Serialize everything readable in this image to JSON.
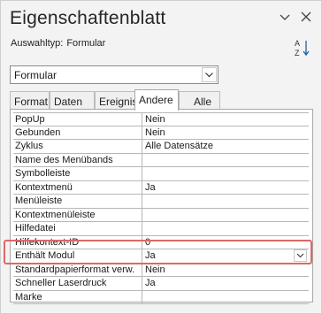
{
  "panel": {
    "title": "Eigenschaftenblatt",
    "selection_type_label": "Auswahltyp:",
    "selection_type_value": "Formular"
  },
  "object_combo": {
    "value": "Formular"
  },
  "tabs": [
    {
      "label": "Format"
    },
    {
      "label": "Daten"
    },
    {
      "label": "Ereignis"
    },
    {
      "label": "Andere",
      "active": true
    },
    {
      "label": "Alle"
    }
  ],
  "properties": [
    {
      "label": "PopUp",
      "value": "Nein"
    },
    {
      "label": "Gebunden",
      "value": "Nein"
    },
    {
      "label": "Zyklus",
      "value": "Alle Datensätze"
    },
    {
      "label": "Name des Menübands",
      "value": ""
    },
    {
      "label": "Symbolleiste",
      "value": ""
    },
    {
      "label": "Kontextmenü",
      "value": "Ja"
    },
    {
      "label": "Menüleiste",
      "value": ""
    },
    {
      "label": "Kontextmenüleiste",
      "value": ""
    },
    {
      "label": "Hilfedatei",
      "value": ""
    },
    {
      "label": "Hilfekontext-ID",
      "value": "0"
    },
    {
      "label": "Enthält Modul",
      "value": "Ja"
    },
    {
      "label": "Standardpapierformat verw.",
      "value": "Nein"
    },
    {
      "label": "Schneller Laserdruck",
      "value": "Ja"
    },
    {
      "label": "Marke",
      "value": ""
    }
  ],
  "icons": {
    "header_menu": "chevron-down-icon",
    "close": "close-icon",
    "sort": "sort-az-icon",
    "dropdown": "chevron-down-icon"
  },
  "colors": {
    "highlight": "#e06767"
  }
}
